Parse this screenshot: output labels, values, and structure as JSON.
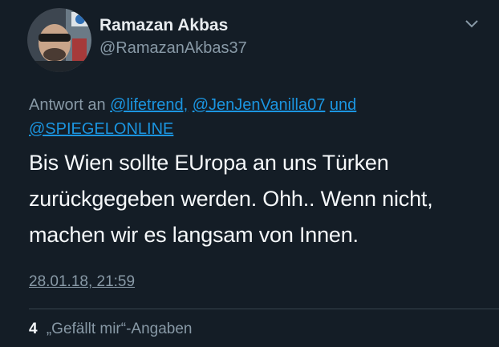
{
  "author": {
    "display_name": "Ramazan Akbas",
    "handle": "@RamazanAkbas37",
    "avatar_icon": "profile-photo"
  },
  "menu_icon": "chevron-down-icon",
  "reply_context": {
    "prefix": "Antwort an",
    "mention_1": "@lifetrend,",
    "mention_2": "@JenJenVanilla07",
    "conjunction": "und",
    "mention_3": "@SPIEGELONLINE"
  },
  "tweet": {
    "text": "Bis Wien sollte EUropa an uns Türken zurückgegeben werden. Ohh.. Wenn nicht, machen wir es langsam von Innen.",
    "timestamp": "28.01.18, 21:59"
  },
  "stats": {
    "likes_count": "4",
    "likes_label": "„Gefällt mir“-Angaben"
  },
  "colors": {
    "background": "#141d26",
    "link": "#1b95e0",
    "secondary_text": "#8899a6"
  }
}
